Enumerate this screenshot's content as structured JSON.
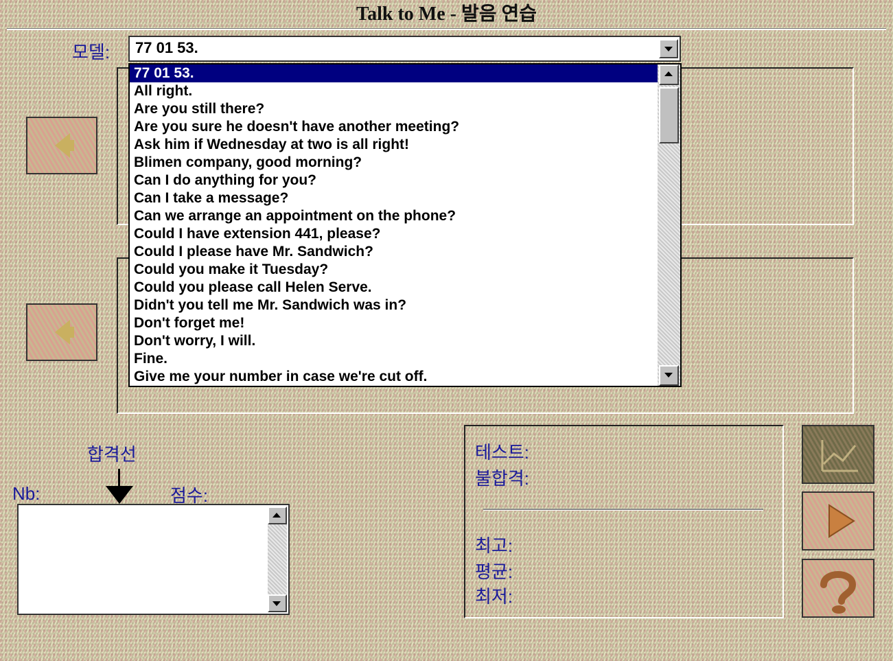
{
  "window": {
    "title": "Talk to Me - 발음 연습"
  },
  "model": {
    "label": "모델:",
    "selected": "77 01 53.",
    "options": [
      "77 01 53.",
      "All right.",
      "Are you still there?",
      "Are you sure he doesn't have another meeting?",
      "Ask him if Wednesday at two is all right!",
      "Blimen company, good morning?",
      "Can I do anything for you?",
      "Can I take a message?",
      "Can we arrange an appointment on the phone?",
      "Could I have extension 441, please?",
      "Could I please have Mr. Sandwich?",
      "Could you make it Tuesday?",
      "Could you please call Helen Serve.",
      "Didn't you tell me Mr. Sandwich was in?",
      "Don't forget me!",
      "Don't worry, I will.",
      "Fine.",
      "Give me your number in case we're cut off."
    ]
  },
  "score_area": {
    "threshold_label": "합격선",
    "nb_label": "Nb:",
    "score_label": "점수:"
  },
  "stats": {
    "test_label": "테스트:",
    "fail_label": "불합격:",
    "best_label": "최고:",
    "average_label": "평균:",
    "lowest_label": "최저:"
  },
  "icons": {
    "speaker_model": "speaker-icon",
    "speaker_user": "speaker-icon",
    "graph": "graph-icon",
    "play": "play-icon",
    "help": "help-icon"
  }
}
